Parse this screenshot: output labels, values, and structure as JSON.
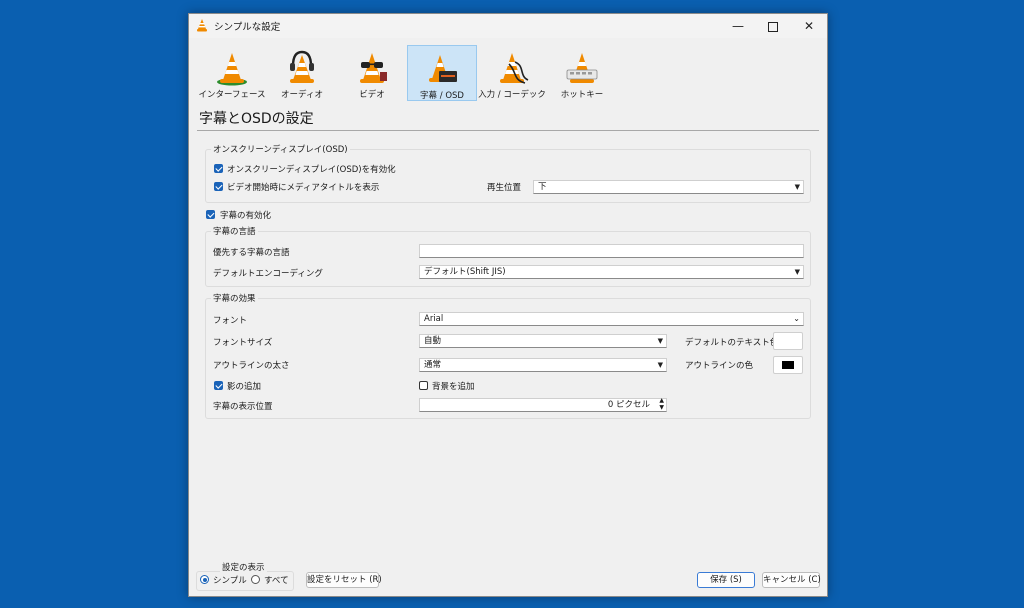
{
  "window": {
    "title": "シンプルな設定"
  },
  "tabs": [
    {
      "label": "インターフェース",
      "icon": "interface-cone-icon"
    },
    {
      "label": "オーディオ",
      "icon": "audio-headphones-cone-icon"
    },
    {
      "label": "ビデオ",
      "icon": "video-sunglasses-cone-icon"
    },
    {
      "label": "字幕 / OSD",
      "icon": "subtitles-cone-icon",
      "selected": true
    },
    {
      "label": "入力 / コーデック",
      "icon": "input-codec-cone-icon"
    },
    {
      "label": "ホットキー",
      "icon": "hotkeys-cone-icon"
    }
  ],
  "page_title": "字幕とOSDの設定",
  "osd": {
    "group_label": "オンスクリーンディスプレイ(OSD)",
    "enable_osd_label": "オンスクリーンディスプレイ(OSD)を有効化",
    "enable_osd_checked": true,
    "show_title_label": "ビデオ開始時にメディアタイトルを表示",
    "show_title_checked": true,
    "position_label": "再生位置",
    "position_value": "下"
  },
  "subtitles": {
    "enable_label": "字幕の有効化",
    "enable_checked": true,
    "language": {
      "group_label": "字幕の言語",
      "preferred_label": "優先する字幕の言語",
      "preferred_value": "",
      "encoding_label": "デフォルトエンコーディング",
      "encoding_value": "デフォルト(Shift JIS)"
    },
    "effects": {
      "group_label": "字幕の効果",
      "font_label": "フォント",
      "font_value": "Arial",
      "font_size_label": "フォントサイズ",
      "font_size_value": "自動",
      "text_color_label": "デフォルトのテキスト色",
      "text_color": "#ffffff",
      "outline_thickness_label": "アウトラインの太さ",
      "outline_thickness_value": "通常",
      "outline_color_label": "アウトラインの色",
      "outline_color": "#000000",
      "shadow_label": "影の追加",
      "shadow_checked": true,
      "background_label": "背景を追加",
      "background_checked": false,
      "position_label": "字幕の表示位置",
      "position_value": "0 ピクセル"
    }
  },
  "footer": {
    "show_settings_label": "設定の表示",
    "simple_label": "シンプル",
    "all_label": "すべて",
    "simple_selected": true,
    "reset_label": "設定をリセット (R)",
    "save_label": "保存 (S)",
    "cancel_label": "キャンセル (C)"
  },
  "colors": {
    "desktop": "#0a5fb0",
    "accent": "#1a63b8",
    "cone_orange": "#f08a00"
  }
}
